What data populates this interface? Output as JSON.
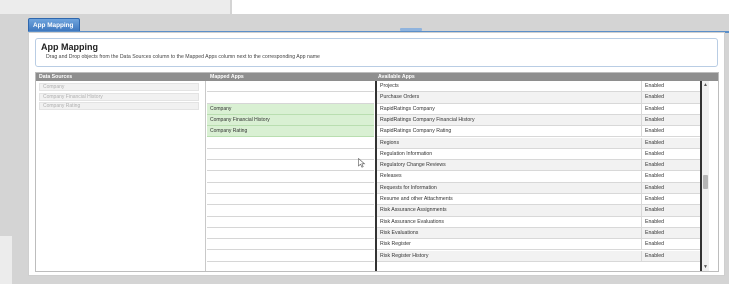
{
  "tab": {
    "label": "App Mapping"
  },
  "header": {
    "title": "App Mapping",
    "instructions": "Drag and Drop objects from the Data Sources column to the Mapped Apps column next to the corresponding App name"
  },
  "columns": {
    "sources": "Data Sources",
    "mapped": "Mapped Apps",
    "available": "Available Apps"
  },
  "data_sources": [
    "Company",
    "Company Financial History",
    "Company Rating"
  ],
  "mapped_apps": [
    "",
    "",
    "Company",
    "Company Financial History",
    "Company Rating",
    "",
    "",
    "",
    "",
    "",
    "",
    "",
    "",
    "",
    "",
    "",
    ""
  ],
  "available_apps": [
    {
      "name": "Projects",
      "status": "Enabled"
    },
    {
      "name": "Purchase Orders",
      "status": "Enabled"
    },
    {
      "name": "RapidRatings Company",
      "status": "Enabled"
    },
    {
      "name": "RapidRatings Company Financial History",
      "status": "Enabled"
    },
    {
      "name": "RapidRatings Company Rating",
      "status": "Enabled"
    },
    {
      "name": "Regions",
      "status": "Enabled"
    },
    {
      "name": "Regulation Information",
      "status": "Enabled"
    },
    {
      "name": "Regulatory Change Reviews",
      "status": "Enabled"
    },
    {
      "name": "Releases",
      "status": "Enabled"
    },
    {
      "name": "Requests for Information",
      "status": "Enabled"
    },
    {
      "name": "Resume and other Attachments",
      "status": "Enabled"
    },
    {
      "name": "Risk Assurance Assignments",
      "status": "Enabled"
    },
    {
      "name": "Risk Assurance Evaluations",
      "status": "Enabled"
    },
    {
      "name": "Risk Evaluations",
      "status": "Enabled"
    },
    {
      "name": "Risk Register",
      "status": "Enabled"
    },
    {
      "name": "Risk Register History",
      "status": "Enabled"
    }
  ],
  "icons": {
    "scroll_up": "chevron-up-icon",
    "scroll_down": "chevron-down-icon",
    "cursor": "mouse-pointer-icon"
  },
  "colors": {
    "tab": "#3f78bf",
    "mapped_fill": "#d9f0d3",
    "grid_header": "#8e8e8e"
  }
}
